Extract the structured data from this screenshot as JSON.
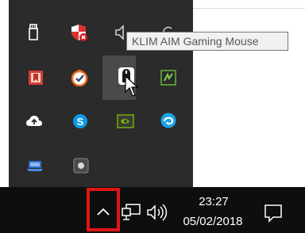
{
  "tooltip": {
    "text": "KLIM AIM Gaming Mouse"
  },
  "overflow_icons": [
    "usb-safely-remove-icon",
    "defender-shield-icon",
    "volume-mixer-icon",
    "update-arrows-icon",
    "red-bookmark-app-icon",
    "orange-check-app-icon",
    "klim-mouse-app-icon",
    "green-app-icon",
    "cloud-upload-icon",
    "skype-icon",
    "nvidia-icon",
    "blue-swirl-app-icon",
    "blue-laptop-app-icon",
    "small-app-icon"
  ],
  "taskbar": {
    "show_hidden_icons": "chevron-up-icon",
    "network_icon": "network-icon",
    "volume_icon": "speaker-icon",
    "clock_time": "23:27",
    "clock_date": "05/02/2018",
    "notifications_icon": "action-center-icon"
  },
  "colors": {
    "overflow_bg": "#2b2b2b",
    "taskbar_bg": "#0e0e0e",
    "highlight_box": "#e01515"
  }
}
